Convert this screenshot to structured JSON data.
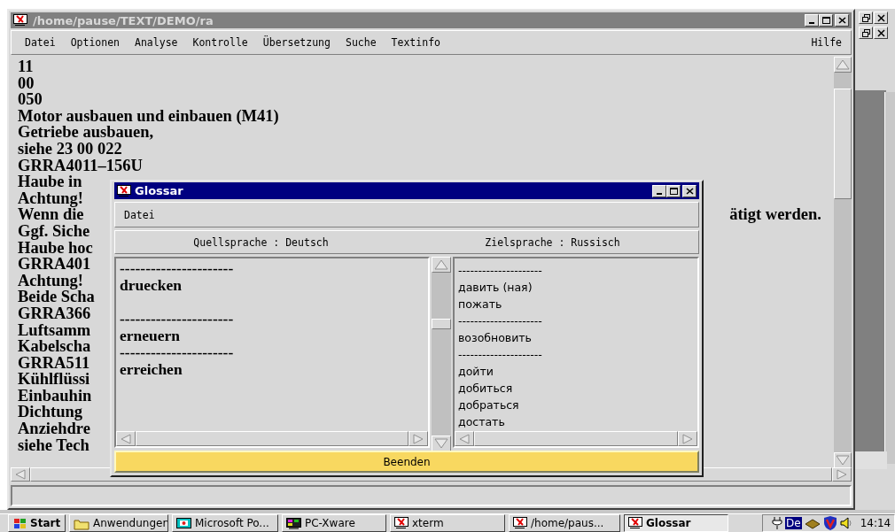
{
  "main_window": {
    "title": "/home/pause/TEXT/DEMO/ra",
    "menu": [
      {
        "label": "Datei"
      },
      {
        "label": "Optionen"
      },
      {
        "label": "Analyse"
      },
      {
        "label": "Kontrolle"
      },
      {
        "label": "Übersetzung"
      },
      {
        "label": "Suche"
      },
      {
        "label": "Textinfo"
      }
    ],
    "help_menu": {
      "label": "Hilfe"
    },
    "text_lines": [
      {
        "text": "11"
      },
      {
        "text": "00"
      },
      {
        "text": "050"
      },
      {
        "text": "Motor ausbauen und einbauen (M41)"
      },
      {
        "text": "Getriebe ausbauen,"
      },
      {
        "text": "siehe 23 00 022"
      },
      {
        "text": "GRRA4011–156U"
      },
      {
        "text": "Haube in"
      },
      {
        "text": "Achtung!"
      },
      {
        "text": "Wenn die",
        "tail": "ätigt werden."
      },
      {
        "text": "Ggf. Siche"
      },
      {
        "text": "Haube hoc"
      },
      {
        "text": "GRRA401"
      },
      {
        "text": "Achtung!"
      },
      {
        "text": "Beide Scha"
      },
      {
        "text": "GRRA366"
      },
      {
        "text": "Luftsamm"
      },
      {
        "text": "Kabelscha"
      },
      {
        "text": "GRRA511"
      },
      {
        "text": "Kühlflüssi"
      },
      {
        "text": "Einbauhin"
      },
      {
        "text": "Dichtung"
      },
      {
        "text": "Anziehdre"
      },
      {
        "text": "siehe Tech"
      }
    ]
  },
  "glossary_dialog": {
    "title": "Glossar",
    "menu": [
      "Datei"
    ],
    "source_language": "Quellsprache : Deutsch",
    "target_language": "Zielsprache : Russisch",
    "source_entries": [
      {
        "kind": "text",
        "text": "----------------------"
      },
      {
        "kind": "text",
        "text": "druecken"
      },
      {
        "kind": "blank"
      },
      {
        "kind": "text",
        "text": "----------------------"
      },
      {
        "kind": "text",
        "text": "erneuern"
      },
      {
        "kind": "text",
        "text": "----------------------"
      },
      {
        "kind": "text",
        "text": "erreichen"
      }
    ],
    "target_entries": [
      "---------------------",
      "давить (ная)",
      "пожать",
      "---------------------",
      "возобновить",
      "---------------------",
      "дойти",
      "добиться",
      "добраться",
      "достать"
    ],
    "close_button": "Beenden"
  },
  "taskbar": {
    "start": "Start",
    "items": [
      {
        "label": "Anwendungen",
        "selected": false
      },
      {
        "label": "Microsoft Po...",
        "selected": false
      },
      {
        "label": "PC-Xware",
        "selected": false
      },
      {
        "label": "xterm",
        "selected": false
      },
      {
        "label": "/home/paus...",
        "selected": false
      },
      {
        "label": "Glossar",
        "selected": true
      }
    ],
    "keyboard_language": "De",
    "clock": "14:14"
  }
}
